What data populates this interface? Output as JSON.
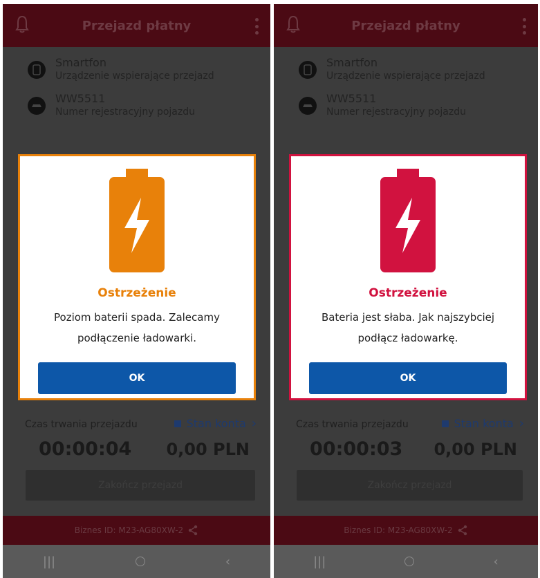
{
  "screens": [
    {
      "header_title": "Przejazd płatny",
      "device_name": "Smartfon",
      "device_desc": "Urządzenie wspierające przejazd",
      "plate": "WW5511",
      "plate_desc": "Numer rejestracyjny pojazdu",
      "dialog": {
        "title": "Ostrzeżenie",
        "message": "Poziom baterii spada. Zalecamy podłączenie ładowarki.",
        "ok_label": "OK",
        "accent_color": "#e8810a"
      },
      "timer_label": "Czas trwania przejazdu",
      "account_link": "Stan konta",
      "elapsed_time": "00:00:04",
      "amount": "0,00 PLN",
      "end_button": "Zakończ przejazd",
      "business_id": "Biznes ID:  M23-AG80XW-2"
    },
    {
      "header_title": "Przejazd płatny",
      "device_name": "Smartfon",
      "device_desc": "Urządzenie wspierające przejazd",
      "plate": "WW5511",
      "plate_desc": "Numer rejestracyjny pojazdu",
      "dialog": {
        "title": "Ostrzeżenie",
        "message": "Bateria jest słaba. Jak najszybciej podłącz ładowarkę.",
        "ok_label": "OK",
        "accent_color": "#d1123f"
      },
      "timer_label": "Czas trwania przejazdu",
      "account_link": "Stan konta",
      "elapsed_time": "00:00:03",
      "amount": "0,00 PLN",
      "end_button": "Zakończ przejazd",
      "business_id": "Biznes ID:  M23-AG80XW-2"
    }
  ],
  "icons": {
    "header_left": "bell-icon",
    "header_right": "kebab-menu-icon",
    "device": "smartphone-icon",
    "vehicle": "car-icon",
    "battery": "battery-charging-icon",
    "account": "wallet-icon",
    "share": "share-icon",
    "nav_recent": "recent-apps-icon",
    "nav_home": "home-icon",
    "nav_back": "back-icon"
  }
}
